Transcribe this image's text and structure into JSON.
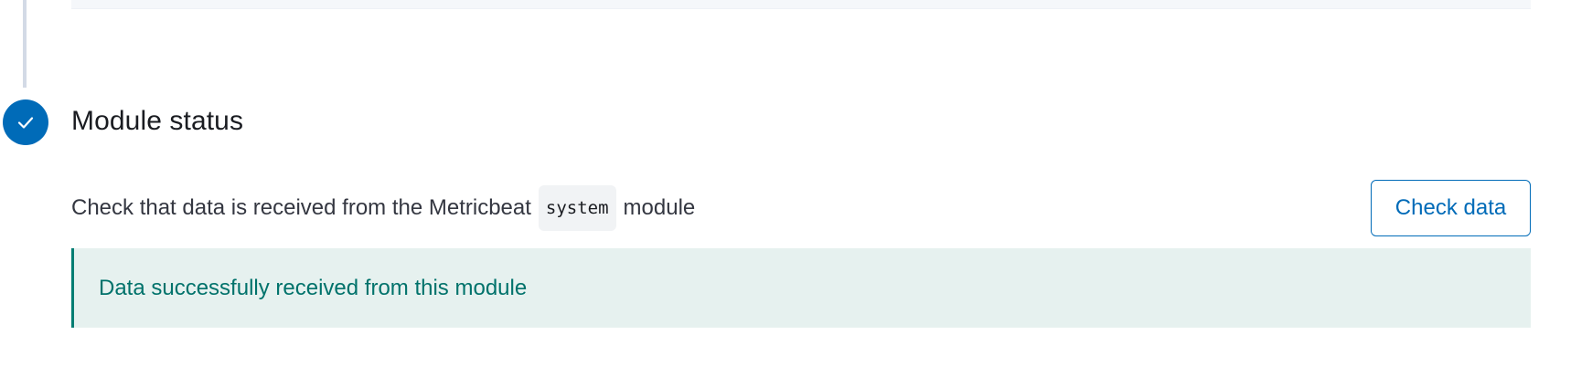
{
  "step": {
    "title": "Module status",
    "status_icon": "check-icon",
    "accent_color": "#006bb8"
  },
  "description": {
    "before": "Check that data is received from the Metricbeat",
    "code": "system",
    "after": "module"
  },
  "check_button": {
    "label": "Check data"
  },
  "callout": {
    "message": "Data successfully received from this module",
    "color": "#017d73"
  }
}
